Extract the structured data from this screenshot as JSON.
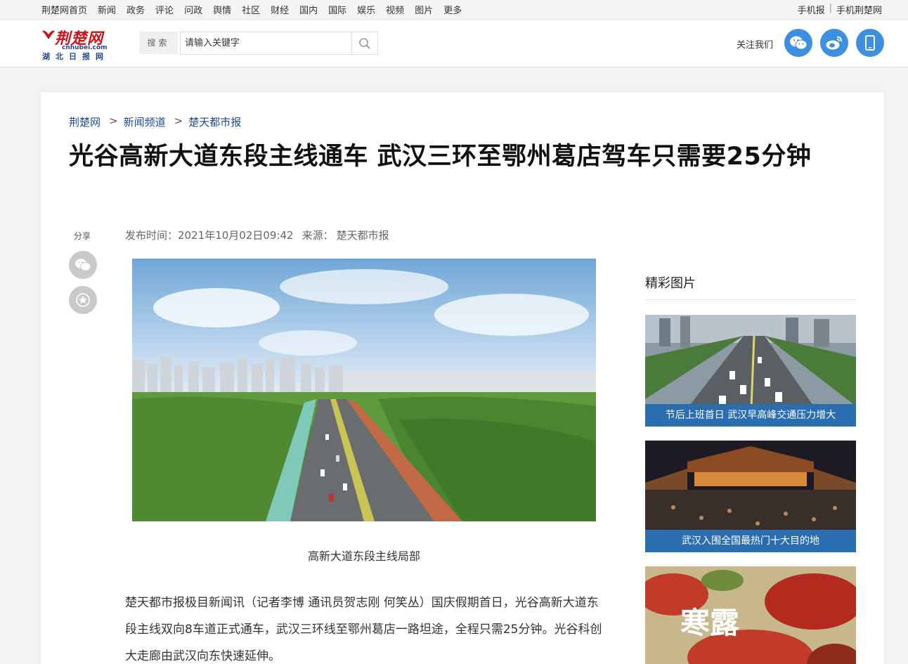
{
  "topnav": {
    "links": [
      "荆楚网首页",
      "新闻",
      "政务",
      "评论",
      "问政",
      "舆情",
      "社区",
      "财经",
      "国内",
      "国际",
      "娱乐",
      "视频",
      "图片",
      "更多"
    ],
    "right": [
      "手机报",
      "手机荆楚网"
    ]
  },
  "header": {
    "logo_cn": "荆楚网",
    "logo_en": "cnhubei.com",
    "logo_sub": "湖北日报网",
    "search_label": "搜索",
    "search_placeholder": "请输入关键字",
    "follow_label": "关注我们",
    "social_icons": [
      "wechat-icon",
      "weibo-icon",
      "mobile-icon"
    ]
  },
  "article": {
    "breadcrumb": [
      "荆楚网",
      "新闻频道",
      "楚天都市报"
    ],
    "title": "光谷高新大道东段主线通车 武汉三环至鄂州葛店驾车只需要25分钟",
    "share_label": "分享",
    "publish_label": "发布时间：",
    "publish_time": "2021年10月02日09:42",
    "source_label": "来源：",
    "source": "楚天都市报",
    "caption": "高新大道东段主线局部",
    "paragraph": "楚天都市报极目新闻讯（记者李博 通讯员贺志刚 何笑丛）国庆假期首日，光谷高新大道东段主线双向8车道正式通车，武汉三环线至鄂州葛店一路坦途，全程只需25分钟。光谷科创大走廊由武汉向东快速延伸。"
  },
  "sidebar": {
    "title": "精彩图片",
    "items": [
      {
        "caption": "节后上班首日 武汉早高峰交通压力增大"
      },
      {
        "caption": "武汉入围全国最热门十大目的地"
      },
      {
        "caption": "寒露",
        "image_text": "寒露"
      }
    ]
  },
  "colors": {
    "accent": "#3d8fe0",
    "caption_bar": "#2a6db0",
    "logo_red": "#c8161d",
    "logo_blue": "#1f4b8e"
  }
}
